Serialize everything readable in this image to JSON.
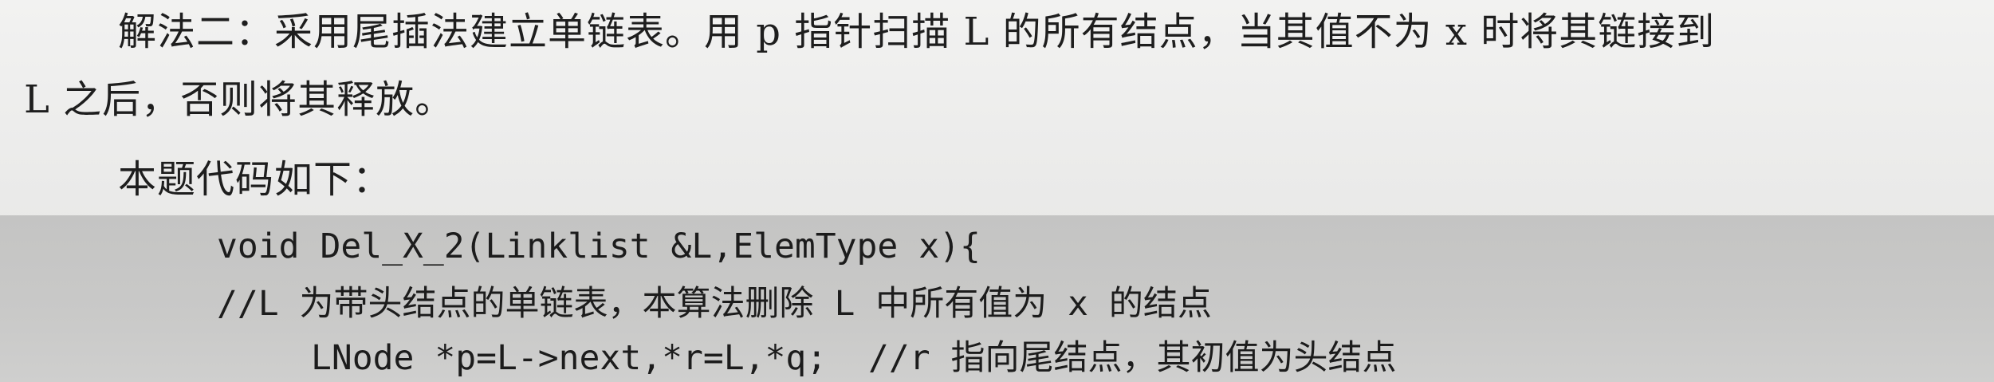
{
  "text": {
    "line1": "解法二：采用尾插法建立单链表。用 p 指针扫描 L 的所有结点，当其值不为 x 时将其链接到",
    "line2": "L 之后，否则将其释放。",
    "line3": "本题代码如下："
  },
  "code": {
    "line1": "void Del_X_2(Linklist &L,ElemType x){",
    "line2": "//L 为带头结点的单链表，本算法删除 L 中所有值为 x 的结点",
    "line3": "LNode *p=L->next,*r=L,*q;  //r 指向尾结点，其初值为头结点"
  }
}
